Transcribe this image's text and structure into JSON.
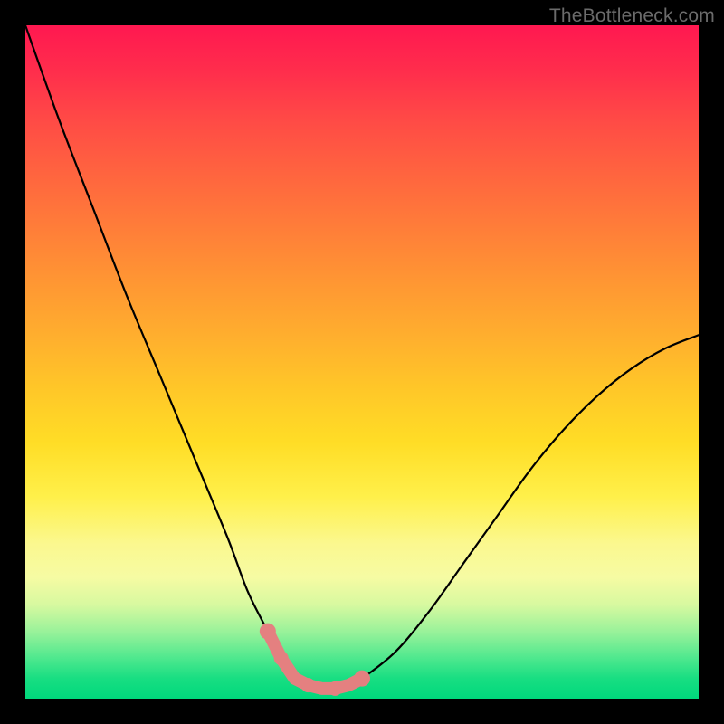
{
  "watermark": "TheBottleneck.com",
  "colors": {
    "frame": "#000000",
    "curve": "#000000",
    "marker": "#e48080",
    "gradient_top": "#ff1850",
    "gradient_bottom": "#00d87c"
  },
  "chart_data": {
    "type": "line",
    "title": "",
    "xlabel": "",
    "ylabel": "",
    "ylim": [
      0,
      100
    ],
    "xlim": [
      0,
      100
    ],
    "series": [
      {
        "name": "bottleneck-curve",
        "x": [
          0,
          5,
          10,
          15,
          20,
          25,
          30,
          33,
          36,
          38,
          40,
          42,
          44,
          46,
          48,
          50,
          55,
          60,
          65,
          70,
          75,
          80,
          85,
          90,
          95,
          100
        ],
        "y": [
          100,
          86,
          73,
          60,
          48,
          36,
          24,
          16,
          10,
          6,
          3,
          2,
          1.5,
          1.5,
          2,
          3,
          7,
          13,
          20,
          27,
          34,
          40,
          45,
          49,
          52,
          54
        ]
      }
    ],
    "highlight_segment": {
      "x_start": 38,
      "x_end": 50,
      "note": "optimal / no-bottleneck region"
    }
  }
}
